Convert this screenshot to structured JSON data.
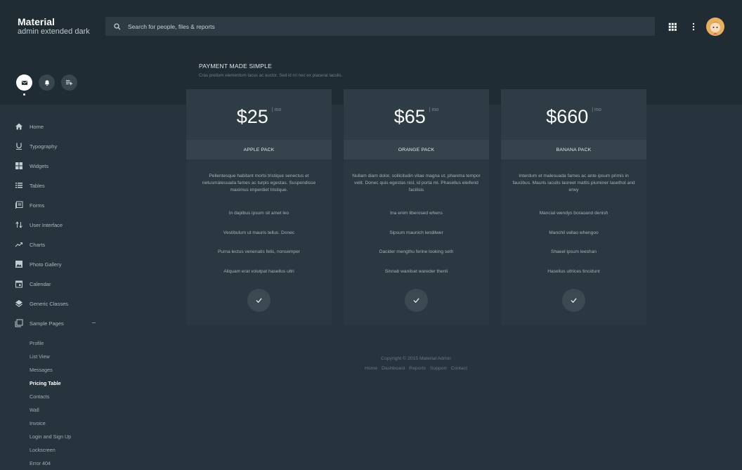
{
  "brand": {
    "title": "Material",
    "subtitle": "admin extended dark"
  },
  "search": {
    "placeholder": "Search for people, files & reports"
  },
  "icons": {
    "search": "search-icon",
    "apps": "apps-grid-icon",
    "more": "more-vertical-icon",
    "mail": "mail-icon",
    "bell": "bell-icon",
    "playlist": "playlist-add-icon",
    "check": "check-icon"
  },
  "colors": {
    "background": "#26343d",
    "header": "#1f2c34",
    "card": "#2a3841",
    "accent": "#ffffff"
  },
  "sidebar": {
    "items": [
      {
        "label": "Home",
        "icon": "home-icon"
      },
      {
        "label": "Typography",
        "icon": "format-underline-icon"
      },
      {
        "label": "Widgets",
        "icon": "widgets-icon"
      },
      {
        "label": "Tables",
        "icon": "list-icon"
      },
      {
        "label": "Forms",
        "icon": "forms-icon"
      },
      {
        "label": "User Interface",
        "icon": "swap-icon"
      },
      {
        "label": "Charts",
        "icon": "trending-up-icon"
      },
      {
        "label": "Photo Gallery",
        "icon": "image-icon"
      },
      {
        "label": "Calendar",
        "icon": "calendar-icon"
      },
      {
        "label": "Generic Classes",
        "icon": "layers-icon"
      },
      {
        "label": "Sample Pages",
        "icon": "pages-icon"
      }
    ],
    "subitems": [
      {
        "label": "Profile"
      },
      {
        "label": "List View"
      },
      {
        "label": "Messages"
      },
      {
        "label": "Pricing Table"
      },
      {
        "label": "Contacts"
      },
      {
        "label": "Wall"
      },
      {
        "label": "Invoice"
      },
      {
        "label": "Login and Sign Up"
      },
      {
        "label": "Lockscreen"
      },
      {
        "label": "Error 404"
      }
    ]
  },
  "page": {
    "title": "PAYMENT MADE SIMPLE",
    "subtitle": "Cras pretium elementum lacus ac auctor. Sed id mi nec ex placerat iaculis."
  },
  "cards": [
    {
      "price": "$25",
      "period": "| mo",
      "name": "APPLE PACK",
      "description": "Pellentesque habitant morbi tristique senectus et netusmalesuada fames ac turpis egestas. Suspendisse maximus imperdiet tristique.",
      "features": [
        "In dapibus ipsum sit amet leo",
        "Vestibulum ut mauris tellus. Donec",
        "Purna lectus venenatis felis, nonsemper",
        "Aliquam erat volutpat hasellus ultri"
      ]
    },
    {
      "price": "$65",
      "period": "| mo",
      "name": "ORANGE PACK",
      "description": "Nullam diam dolor, sollicitudin vitae magna ut, pharetra tempor velit. Donec quis egestas nisl, id porta mi. Phasellus eleifend facilisis",
      "features": [
        "Ina enim liberosed whens",
        "Sipsum maunich lendilwer",
        "Dacider mengthu ferine looking seth",
        "Sinnab wanilset wareder thenli"
      ]
    },
    {
      "price": "$660",
      "period": "| mo",
      "name": "BANANA PACK",
      "description": "Interdum et malesuada fames ac ante ipsum primis in faucibus. Mauris iaculis laoreet mattis piuminer lasethol and envy",
      "features": [
        "Mancial wendys boraoand denish",
        "Manchil vallao whengoo",
        "Shaeel ipsum leeshan",
        "Hasellus ultrices tincidunt"
      ]
    }
  ],
  "footer": {
    "copyright": "Copyright © 2015 Material Admin",
    "links": [
      "Home",
      "Dashboard",
      "Reports",
      "Support",
      "Contact"
    ]
  }
}
